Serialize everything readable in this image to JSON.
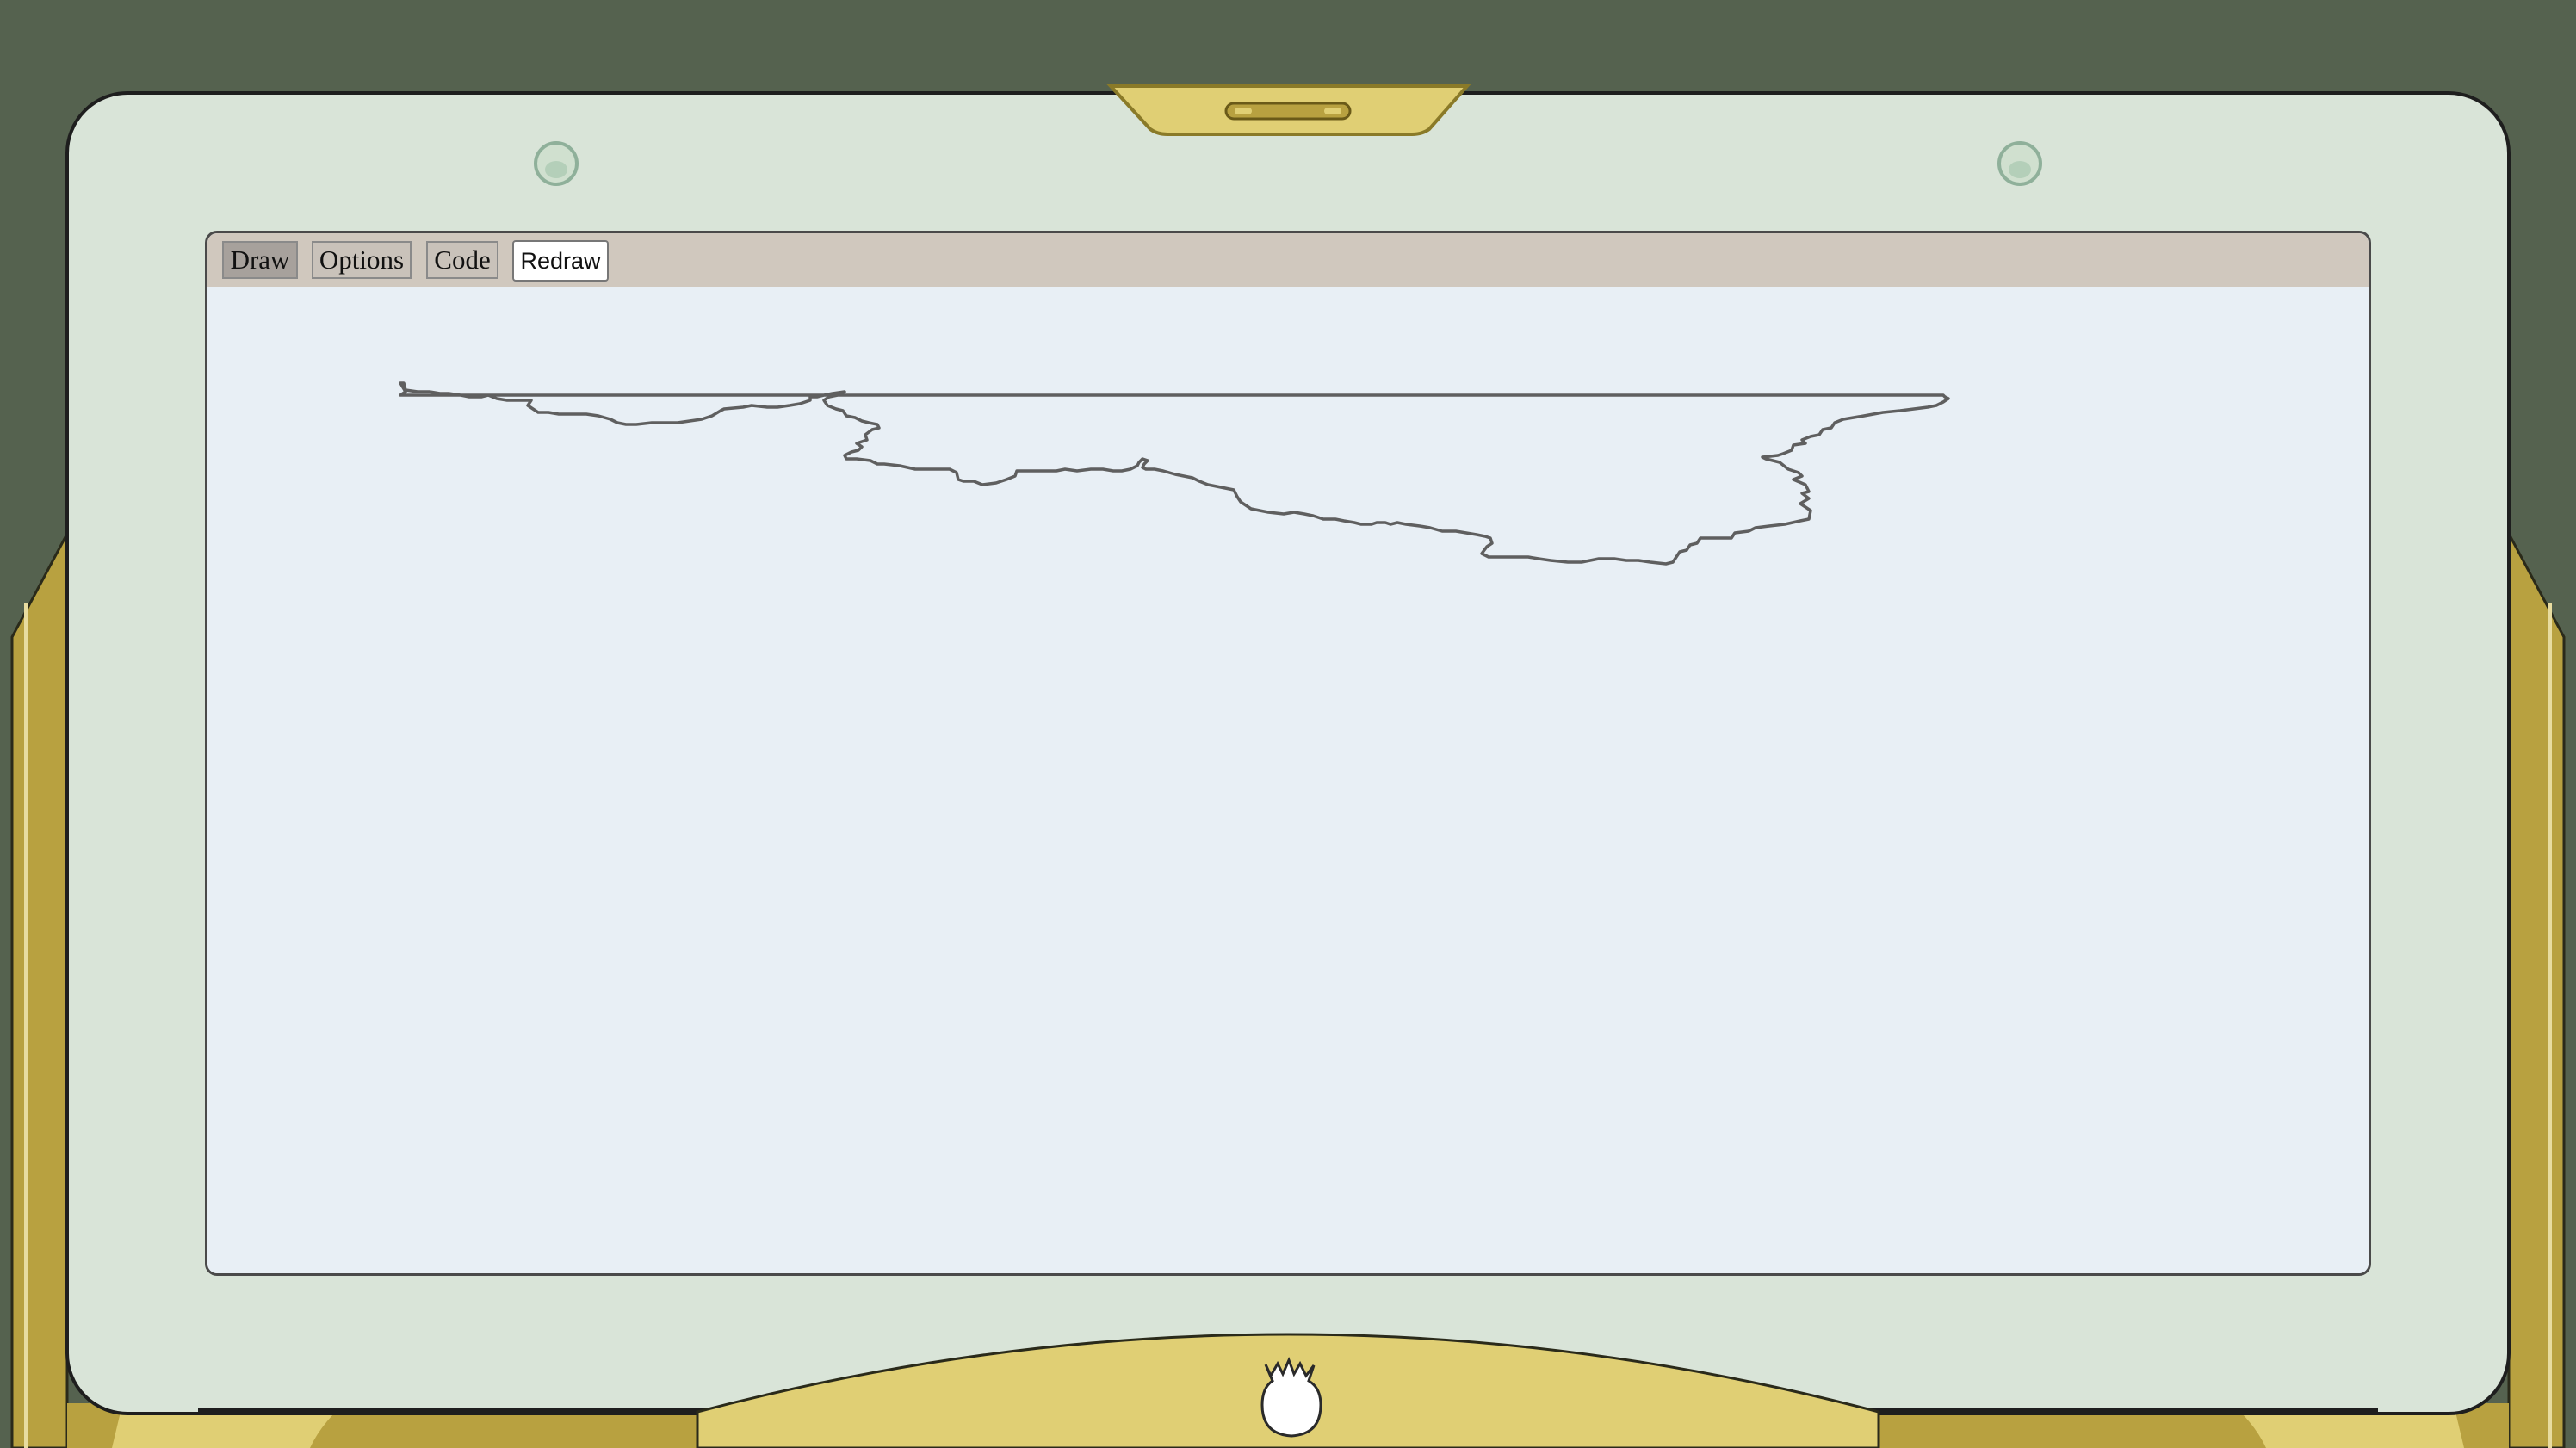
{
  "toolbar": {
    "tabs": [
      {
        "label": "Draw",
        "active": true
      },
      {
        "label": "Options",
        "active": false
      },
      {
        "label": "Code",
        "active": false
      }
    ],
    "redraw_label": "Redraw"
  },
  "colors": {
    "background": "#55624f",
    "bezel": "#d9e4d8",
    "gold": "#e0cf74",
    "gold_dark": "#b8a140",
    "toolbar": "#d0c8be",
    "canvas": "#e8eff5",
    "stroke": "#5f5f5f"
  },
  "icons": {
    "logo": "pineapple-silhouette-icon",
    "hinge": "hinge-latch-icon",
    "camera": "camera-lens-icon"
  }
}
